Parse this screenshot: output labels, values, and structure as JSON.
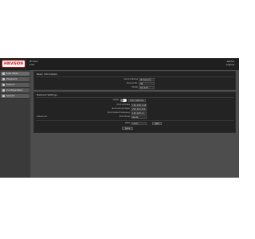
{
  "header": {
    "logo_text": "HIKVISION",
    "device_name": "IP Cam",
    "device_sub": "Live",
    "user_name": "admin",
    "user_action": "Logout"
  },
  "sidebar": {
    "items": [
      {
        "label": "Live View",
        "icon": "camera-icon"
      },
      {
        "label": "Playback",
        "icon": "play-icon"
      },
      {
        "label": "Picture",
        "icon": "image-icon"
      },
      {
        "label": "Configuration",
        "icon": "gear-icon"
      },
      {
        "label": "Search",
        "icon": "search-icon"
      }
    ]
  },
  "panel1": {
    "title": "Basic Information",
    "rows": [
      {
        "label": "Device Name",
        "value": "IP Camera"
      },
      {
        "label": "Device No.",
        "value": "88"
      },
      {
        "label": "Model",
        "value": "DS-2CD"
      }
    ]
  },
  "panel2": {
    "title": "Network Settings",
    "side_label": "Advanced",
    "dhcp_label": "DHCP",
    "toggle_text": "Auto Settings",
    "rows": [
      {
        "label": "IPv4 Address",
        "value": "192.168.1.64"
      },
      {
        "label": "IPv4 Subnet Mask",
        "value": "255.255.255.0"
      },
      {
        "label": "IPv4 Default Gateway",
        "value": "192.168.1.1"
      },
      {
        "label": "IPv6 Mode",
        "value": "Route"
      },
      {
        "label": "MTU",
        "value": "1500"
      }
    ],
    "test_label": "Test",
    "save_label": "Save"
  },
  "watermark": {
    "text": "telno",
    "color": "#d9d9d9"
  },
  "colors": {
    "brand": "#c8161d",
    "background": "#4b4b4b",
    "panel": "#232323"
  }
}
